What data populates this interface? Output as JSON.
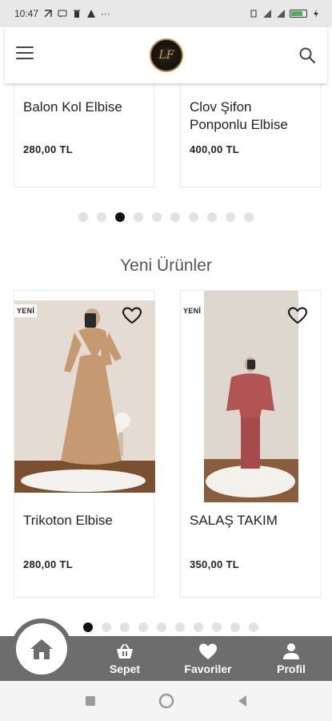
{
  "status_bar": {
    "time": "10:47",
    "overflow": "···",
    "battery_level": "100"
  },
  "header": {
    "logo_mark": "LF"
  },
  "top_products": [
    {
      "name": "Balon Kol Elbise",
      "price": "280,00 TL"
    },
    {
      "name": "Clov Şifon Ponponlu Elbise",
      "price": "400,00 TL"
    }
  ],
  "carousel1": {
    "count": 10,
    "active": 2
  },
  "section": {
    "title": "Yeni Ürünler"
  },
  "new_products": [
    {
      "badge": "YENİ",
      "name": "Trikoton Elbise",
      "price": "280,00 TL",
      "color": "#c59a73"
    },
    {
      "badge": "YENİ",
      "name": "SALAŞ TAKIM",
      "price": "350,00 TL",
      "color": "#b25454"
    }
  ],
  "carousel2": {
    "count": 10,
    "active": 0
  },
  "bottom_nav": {
    "home": "home-icon",
    "items": [
      {
        "label": "Sepet",
        "icon": "basket-icon"
      },
      {
        "label": "Favoriler",
        "icon": "heart-icon"
      },
      {
        "label": "Profil",
        "icon": "user-icon"
      }
    ]
  },
  "colors": {
    "nav_bg": "#6d6d6d",
    "dot_active": "#111111",
    "dot_inactive": "#e2e2e2"
  }
}
